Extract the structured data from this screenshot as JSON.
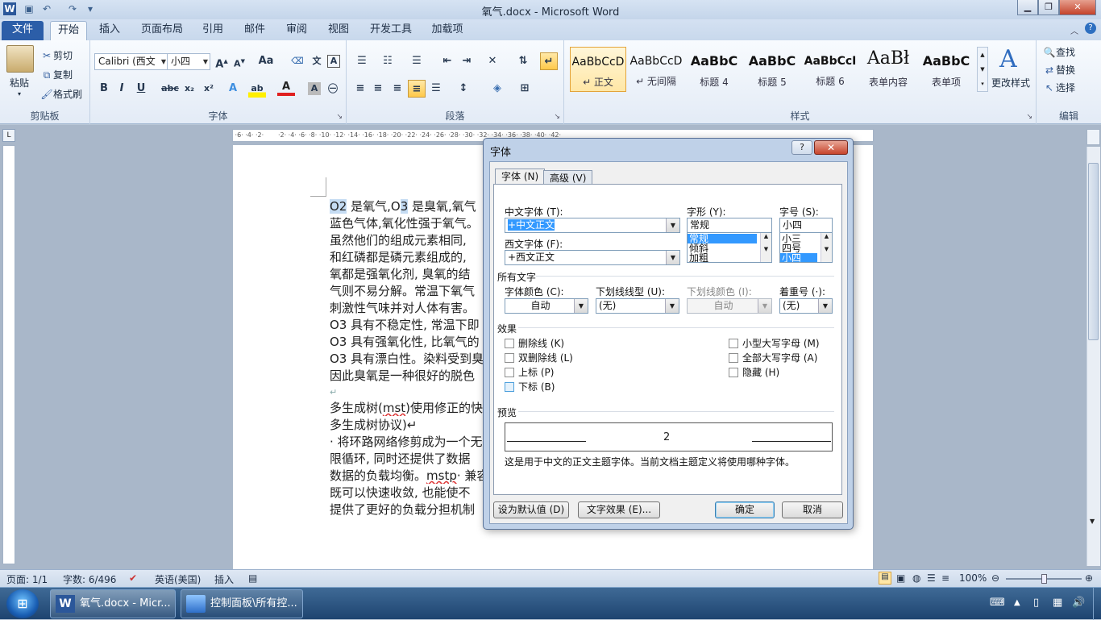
{
  "window": {
    "title": "氧气.docx - Microsoft Word",
    "app_icon": "W"
  },
  "ribbon_tabs": [
    "文件",
    "开始",
    "插入",
    "页面布局",
    "引用",
    "邮件",
    "审阅",
    "视图",
    "开发工具",
    "加载项"
  ],
  "clipboard": {
    "paste": "粘贴",
    "cut": "剪切",
    "copy": "复制",
    "format_painter": "格式刷",
    "group": "剪贴板"
  },
  "font_group": {
    "font_name": "Calibri (西文",
    "font_size": "小四",
    "group": "字体",
    "grow": "A",
    "shrink": "A",
    "case": "Aa"
  },
  "paragraph_group": {
    "group": "段落"
  },
  "styles": {
    "group": "样式",
    "items": [
      {
        "preview": "AaBbCcD",
        "name": "↵ 正文"
      },
      {
        "preview": "AaBbCcD",
        "name": "↵ 无间隔"
      },
      {
        "preview": "AaBbC",
        "name": "标题 4"
      },
      {
        "preview": "AaBbC",
        "name": "标题 5"
      },
      {
        "preview": "AaBbCcI",
        "name": "标题 6"
      },
      {
        "preview": "AaBł",
        "name": "表单内容"
      },
      {
        "preview": "AaBbC",
        "name": "表单项"
      }
    ],
    "change_styles": "更改样式"
  },
  "editing": {
    "find": "查找",
    "replace": "替换",
    "select": "选择",
    "group": "编辑"
  },
  "document": {
    "lines": [
      [
        "O2",
        " 是氧气,O",
        "3",
        " 是臭氧,氧气"
      ],
      [
        "蓝色气体,氧化性强于氧气。"
      ],
      [
        "虽然他们的组成元素相同,"
      ],
      [
        "和红磷都是磷元素组成的,"
      ],
      [
        "氧都是强氧化剂, 臭氧的结"
      ],
      [
        "气则不易分解。常温下氧气"
      ],
      [
        "刺激性气味并对人体有害。"
      ],
      [
        "O3 具有不稳定性, 常温下即"
      ],
      [
        "O3 具有强氧化性, 比氧气的"
      ],
      [
        "O3 具有漂白性。染料受到臭"
      ],
      [
        "因此臭氧是一种很好的脱色"
      ],
      [
        "↵"
      ],
      [
        "多生成树(",
        "mst",
        ")使用修正的快"
      ],
      [
        "多生成树协议)↵"
      ],
      [
        "· 将环路网络修剪成为一个无"
      ],
      [
        "限循环, 同时还提供了数据"
      ],
      [
        "数据的负载均衡。",
        "mstp",
        "· 兼容"
      ],
      [
        "既可以快速收敛, 也能使不"
      ],
      [
        "提供了更好的负载分担机制"
      ]
    ]
  },
  "dialog": {
    "title": "字体",
    "help": "?",
    "close": "✕",
    "tabs": [
      "字体 (N)",
      "高级 (V)"
    ],
    "cn_font_label": "中文字体 (T):",
    "cn_font_value": "+中文正文",
    "west_font_label": "西文字体 (F):",
    "west_font_value": "+西文正文",
    "style_label": "字形 (Y):",
    "style_value": "常规",
    "style_options": [
      "常规",
      "倾斜",
      "加粗"
    ],
    "size_label": "字号 (S):",
    "size_value": "小四",
    "size_options": [
      "小三",
      "四号",
      "小四"
    ],
    "all_text": "所有文字",
    "color_label": "字体颜色 (C):",
    "color_value": "自动",
    "underline_label": "下划线线型 (U):",
    "underline_value": "(无)",
    "underline_color_label": "下划线颜色 (I):",
    "underline_color_value": "自动",
    "emphasis_label": "着重号 (·):",
    "emphasis_value": "(无)",
    "effects": "效果",
    "effects_left": [
      "删除线 (K)",
      "双删除线 (L)",
      "上标 (P)",
      "下标 (B)"
    ],
    "effects_right": [
      "小型大写字母 (M)",
      "全部大写字母 (A)",
      "隐藏 (H)"
    ],
    "preview": "预览",
    "preview_text": "2",
    "description": "这是用于中文的正文主题字体。当前文档主题定义将使用哪种字体。",
    "btn_default": "设为默认值 (D)",
    "btn_effects": "文字效果 (E)...",
    "btn_ok": "确定",
    "btn_cancel": "取消"
  },
  "status": {
    "page": "页面: 1/1",
    "words": "字数: 6/496",
    "language": "英语(美国)",
    "mode": "插入",
    "zoom": "100%"
  },
  "taskbar": {
    "start": "⊞",
    "items": [
      "氧气.docx - Micr...",
      "控制面板\\所有控..."
    ]
  }
}
